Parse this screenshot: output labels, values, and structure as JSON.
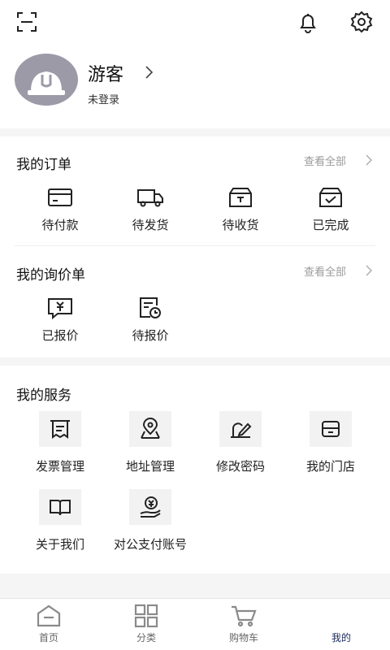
{
  "header": {
    "scan_icon": "scan-icon",
    "notification_icon": "bell-icon",
    "settings_icon": "gear-icon"
  },
  "profile": {
    "name": "游客",
    "status": "未登录"
  },
  "orders": {
    "title": "我的订单",
    "view_all": "查看全部",
    "items": [
      {
        "label": "待付款",
        "icon": "wallet-card-icon"
      },
      {
        "label": "待发货",
        "icon": "truck-icon"
      },
      {
        "label": "待收货",
        "icon": "package-receive-icon"
      },
      {
        "label": "已完成",
        "icon": "box-check-icon"
      }
    ]
  },
  "inquiries": {
    "title": "我的询价单",
    "view_all": "查看全部",
    "items": [
      {
        "label": "已报价",
        "icon": "yen-message-icon"
      },
      {
        "label": "待报价",
        "icon": "document-clock-icon"
      }
    ]
  },
  "services": {
    "title": "我的服务",
    "items": [
      {
        "label": "发票管理",
        "icon": "invoice-icon"
      },
      {
        "label": "地址管理",
        "icon": "map-pin-icon"
      },
      {
        "label": "修改密码",
        "icon": "edit-lock-icon"
      },
      {
        "label": "我的门店",
        "icon": "store-icon"
      },
      {
        "label": "关于我们",
        "icon": "open-book-icon"
      },
      {
        "label": "对公支付账号",
        "icon": "yen-hand-icon"
      }
    ]
  },
  "tabbar": {
    "items": [
      {
        "label": "首页",
        "icon": "home-icon"
      },
      {
        "label": "分类",
        "icon": "grid-icon"
      },
      {
        "label": "购物车",
        "icon": "cart-icon"
      },
      {
        "label": "我的",
        "icon": ""
      }
    ],
    "active_index": 3
  },
  "colors": {
    "avatar_bg": "#9d9aa8",
    "active_tab": "#1a2a5c",
    "muted_text": "#9a9a9a",
    "page_bg": "#f5f5f5"
  }
}
